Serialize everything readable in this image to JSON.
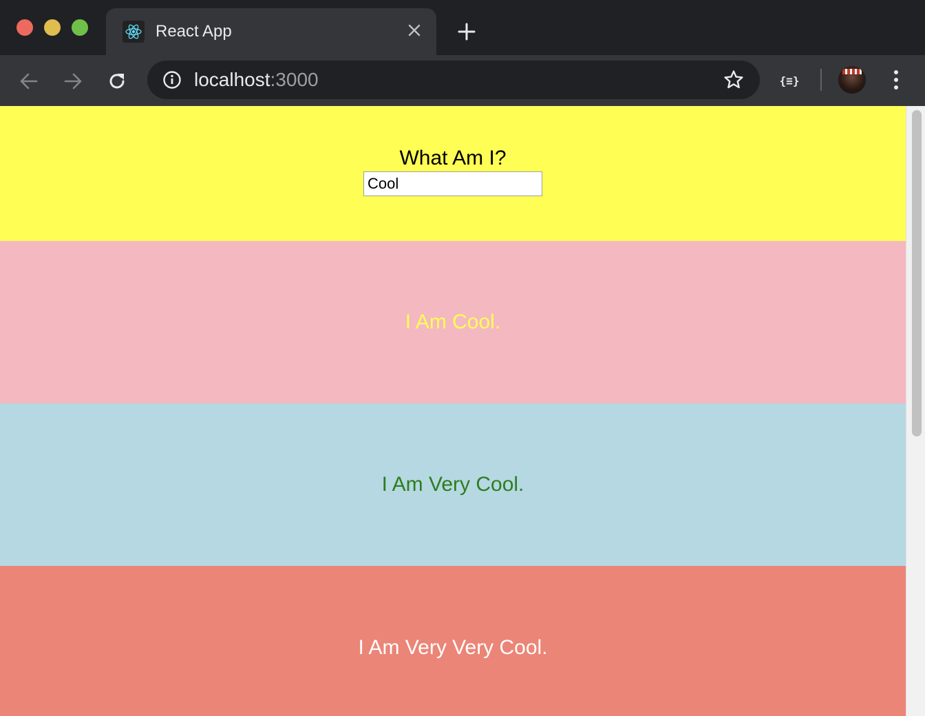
{
  "browser": {
    "tab": {
      "title": "React App",
      "favicon": "react-logo-icon",
      "close_icon": "close-icon"
    },
    "new_tab_icon": "plus-icon",
    "toolbar": {
      "back_icon": "arrow-left-icon",
      "forward_icon": "arrow-right-icon",
      "reload_icon": "reload-icon",
      "url_host": "localhost",
      "url_port": ":3000",
      "extension_label": "{≡}",
      "menu_icon": "three-dots-vertical-icon"
    },
    "colors": {
      "traffic_close": "#ed6a5e",
      "traffic_minimize": "#e0bd4f",
      "traffic_maximize": "#6fc048",
      "react_blue": "#61dafb"
    }
  },
  "page": {
    "question": "What Am I?",
    "input_value": "Cool",
    "sections": [
      {
        "text": "I Am Cool.",
        "background": "#f4b8c0",
        "color": "#fffe55"
      },
      {
        "text": "I Am Very Cool.",
        "background": "#b5d8e2",
        "color": "#2e7d1e"
      },
      {
        "text": "I Am Very Very Cool.",
        "background": "#eb8577",
        "color": "#ffffff"
      }
    ],
    "header_background": "#fffe55"
  }
}
